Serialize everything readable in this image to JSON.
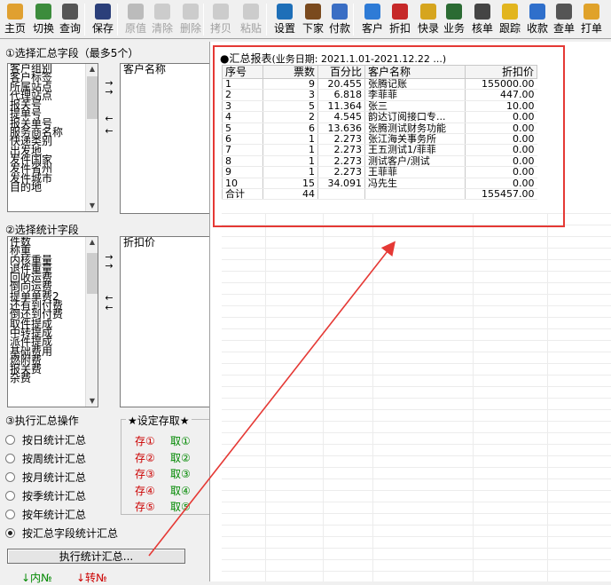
{
  "toolbar": {
    "buttons": [
      {
        "label": "主页",
        "icon": "home-icon",
        "enabled": true
      },
      {
        "label": "切换",
        "icon": "switch-icon",
        "enabled": true
      },
      {
        "label": "查询",
        "icon": "binoculars-icon",
        "enabled": true
      },
      {
        "label": "保存",
        "icon": "save-icon",
        "enabled": true
      },
      {
        "label": "原值",
        "icon": "restore-icon",
        "enabled": false
      },
      {
        "label": "清除",
        "icon": "clear-icon",
        "enabled": false
      },
      {
        "label": "删除",
        "icon": "delete-icon",
        "enabled": false
      },
      {
        "label": "拷贝",
        "icon": "copy-icon",
        "enabled": false
      },
      {
        "label": "粘贴",
        "icon": "paste-icon",
        "enabled": false
      },
      {
        "label": "设置",
        "icon": "settings-icon",
        "enabled": true
      },
      {
        "label": "下家",
        "icon": "next-partner-icon",
        "enabled": true
      },
      {
        "label": "付款",
        "icon": "payment-icon",
        "enabled": true
      },
      {
        "label": "客户",
        "icon": "customer-icon",
        "enabled": true
      },
      {
        "label": "折扣",
        "icon": "discount-icon",
        "enabled": true
      },
      {
        "label": "快录",
        "icon": "quick-entry-icon",
        "enabled": true
      },
      {
        "label": "业务",
        "icon": "business-icon",
        "enabled": true
      },
      {
        "label": "核单",
        "icon": "verify-icon",
        "enabled": true
      },
      {
        "label": "跟踪",
        "icon": "track-icon",
        "enabled": true
      },
      {
        "label": "收款",
        "icon": "receive-icon",
        "enabled": true
      },
      {
        "label": "查单",
        "icon": "find-order-icon",
        "enabled": true
      },
      {
        "label": "打单",
        "icon": "print-icon",
        "enabled": true
      }
    ]
  },
  "left": {
    "summary_fields_title": "①选择汇总字段（最多5个）",
    "summary_fields_options": [
      "客户组别",
      "客户标签",
      "所属站点",
      "代理站点",
      "报关号",
      "提单号",
      "报关单号",
      "服务商名称",
      "快递类别",
      "出发地",
      "发件国家",
      "发件省州",
      "发件城市",
      "目的地"
    ],
    "summary_fields_selected": [
      "客户名称"
    ],
    "stat_fields_title": "②选择统计字段",
    "stat_fields_options": [
      "件数",
      "称重",
      "内核重量",
      "退件重量",
      "回收运费",
      "倒向运费",
      "提单单费2",
      "还有到付费",
      "倒还到付费",
      "取件提成",
      "中转提成",
      "派件提成",
      "基础费用",
      "燃附费",
      "报关费",
      "杂费"
    ],
    "stat_fields_selected": [
      "折扣价"
    ],
    "arrows": {
      "add": "→",
      "remove": "←"
    },
    "exec_title": "③执行汇总操作",
    "radio_options": [
      "按日统计汇总",
      "按周统计汇总",
      "按月统计汇总",
      "按季统计汇总",
      "按年统计汇总",
      "按汇总字段统计汇总"
    ],
    "radio_selected": 5,
    "settings_title": "★设定存取★",
    "store_labels": [
      "存①",
      "存②",
      "存③",
      "存④",
      "存⑤"
    ],
    "fetch_labels": [
      "取①",
      "取②",
      "取③",
      "取④",
      "取⑤"
    ],
    "exec_button": "执行统计汇总...",
    "bottom_links": [
      "↓内№",
      "↓转№"
    ]
  },
  "report": {
    "title_prefix": "●汇总报表",
    "title_date": "(业务日期: 2021.1.01-2021.12.22 ...)",
    "columns": [
      "序号",
      "票数",
      "百分比",
      "客户名称",
      "折扣价"
    ],
    "rows": [
      [
        "1",
        "9",
        "20.455",
        "张腾记账",
        "155000.00"
      ],
      [
        "2",
        "3",
        "6.818",
        "李菲菲",
        "447.00"
      ],
      [
        "3",
        "5",
        "11.364",
        "张三",
        "10.00"
      ],
      [
        "4",
        "2",
        "4.545",
        "韵达订阅接口专...",
        "0.00"
      ],
      [
        "5",
        "6",
        "13.636",
        "张腾测试财务功能",
        "0.00"
      ],
      [
        "6",
        "1",
        "2.273",
        "张江海关事务所",
        "0.00"
      ],
      [
        "7",
        "1",
        "2.273",
        "王五测试1/菲菲",
        "0.00"
      ],
      [
        "8",
        "1",
        "2.273",
        "测试客户/测试",
        "0.00"
      ],
      [
        "9",
        "1",
        "2.273",
        "王菲菲",
        "0.00"
      ],
      [
        "10",
        "15",
        "34.091",
        "冯先生",
        "0.00"
      ]
    ],
    "total": [
      "合计",
      "44",
      "",
      "",
      "155457.00"
    ]
  },
  "colors": {
    "annotation": "#e53935",
    "store": "#cc0000",
    "fetch": "#008800"
  }
}
